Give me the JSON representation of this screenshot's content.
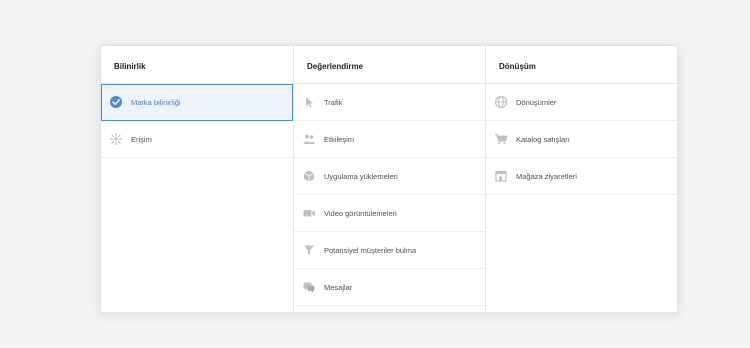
{
  "columns": [
    {
      "title": "Bilinirlik",
      "items": [
        {
          "label": "Marka bilinirliği",
          "icon": "check-circle-icon",
          "selected": true
        },
        {
          "label": "Erişim",
          "icon": "reach-icon",
          "selected": false
        }
      ]
    },
    {
      "title": "Değerlendirme",
      "items": [
        {
          "label": "Trafik",
          "icon": "cursor-icon"
        },
        {
          "label": "Etkileşim",
          "icon": "people-icon"
        },
        {
          "label": "Uygulama yüklemeleri",
          "icon": "box-icon"
        },
        {
          "label": "Video görüntülemeleri",
          "icon": "video-icon"
        },
        {
          "label": "Potansiyel müşteriler bulma",
          "icon": "funnel-icon"
        },
        {
          "label": "Mesajlar",
          "icon": "chat-icon"
        }
      ]
    },
    {
      "title": "Dönüşüm",
      "items": [
        {
          "label": "Dönüşümler",
          "icon": "globe-icon"
        },
        {
          "label": "Katalog satışları",
          "icon": "cart-icon"
        },
        {
          "label": "Mağaza ziyaretleri",
          "icon": "store-icon"
        }
      ]
    }
  ],
  "colors": {
    "accent": "#4a89dc",
    "selected_bg": "#eef4fd",
    "icon_gray": "#bcc0c7"
  }
}
